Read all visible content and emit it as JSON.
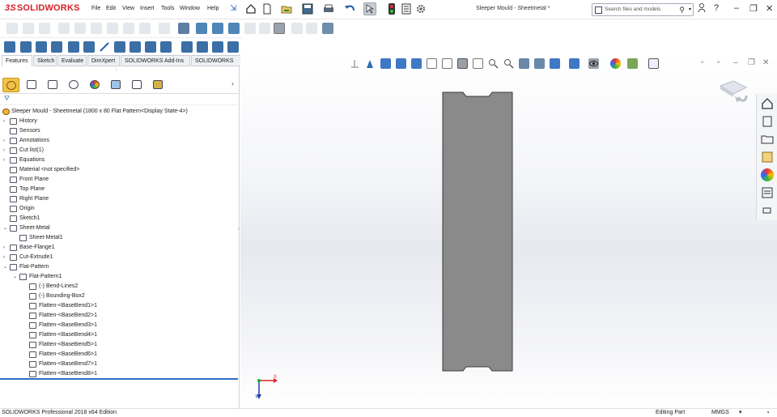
{
  "app": {
    "brand": "SOLIDWORKS",
    "brand_prefix": "3S",
    "document_title": "Sleeper Mould - Sheetmetal *",
    "menu": [
      "File",
      "Edit",
      "View",
      "Insert",
      "Tools",
      "Window",
      "Help"
    ],
    "search_placeholder": "Search files and models",
    "window_controls": {
      "help": "?",
      "minimize": "–",
      "restore": "❐",
      "close": "✕"
    }
  },
  "command_tabs": [
    {
      "label": "Features",
      "active": true
    },
    {
      "label": "Sketch",
      "active": false
    },
    {
      "label": "Evaluate",
      "active": false
    },
    {
      "label": "DimXpert",
      "active": false
    },
    {
      "label": "SOLIDWORKS Add-Ins",
      "active": false
    },
    {
      "label": "SOLIDWORKS CAM",
      "active": false
    }
  ],
  "tree": {
    "root": "Sleeper Mould - Sheetmetal  (1800 x 80 Flat Pattern<Display State-4>)",
    "items": [
      {
        "label": "History",
        "toggle": "›",
        "icon": "history-icon"
      },
      {
        "label": "Sensors",
        "toggle": "",
        "icon": "sensors-icon"
      },
      {
        "label": "Annotations",
        "toggle": "›",
        "icon": "annotations-icon"
      },
      {
        "label": "Cut list(1)",
        "toggle": "›",
        "icon": "cut-list-icon"
      },
      {
        "label": "Equations",
        "toggle": "›",
        "icon": "equations-icon"
      },
      {
        "label": "Material <not specified>",
        "toggle": "",
        "icon": "material-icon"
      },
      {
        "label": "Front Plane",
        "toggle": "",
        "icon": "plane-icon"
      },
      {
        "label": "Top Plane",
        "toggle": "",
        "icon": "plane-icon"
      },
      {
        "label": "Right Plane",
        "toggle": "",
        "icon": "plane-icon"
      },
      {
        "label": "Origin",
        "toggle": "",
        "icon": "origin-icon"
      },
      {
        "label": "Sketch1",
        "toggle": "",
        "icon": "sketch-icon"
      },
      {
        "label": "Sheet-Metal",
        "toggle": "⌄",
        "icon": "sheet-metal-icon"
      },
      {
        "label": "Sheet-Metal1",
        "toggle": "",
        "icon": "sheet-metal-feature-icon"
      },
      {
        "label": "Base-Flange1",
        "toggle": "›",
        "icon": "base-flange-icon"
      },
      {
        "label": "Cut-Extrude1",
        "toggle": "›",
        "icon": "cut-extrude-icon"
      },
      {
        "label": "Flat-Pattern",
        "toggle": "⌄",
        "icon": "flat-pattern-folder-icon"
      },
      {
        "label": "Flat-Pattern1",
        "toggle": "⌄",
        "icon": "flat-pattern-icon"
      },
      {
        "label": "(-) Bend-Lines2",
        "toggle": "",
        "icon": "sketch-icon"
      },
      {
        "label": "(-) Bounding-Box2",
        "toggle": "",
        "icon": "sketch-icon"
      },
      {
        "label": "Flatten-<BaseBend1>1",
        "toggle": "",
        "icon": "flatten-icon"
      },
      {
        "label": "Flatten-<BaseBend2>1",
        "toggle": "",
        "icon": "flatten-icon"
      },
      {
        "label": "Flatten-<BaseBend3>1",
        "toggle": "",
        "icon": "flatten-icon"
      },
      {
        "label": "Flatten-<BaseBend4>1",
        "toggle": "",
        "icon": "flatten-icon"
      },
      {
        "label": "Flatten-<BaseBend5>1",
        "toggle": "",
        "icon": "flatten-icon"
      },
      {
        "label": "Flatten-<BaseBend6>1",
        "toggle": "",
        "icon": "flatten-icon"
      },
      {
        "label": "Flatten-<BaseBend7>1",
        "toggle": "",
        "icon": "flatten-icon"
      },
      {
        "label": "Flatten-<BaseBend8>1",
        "toggle": "",
        "icon": "flatten-icon"
      }
    ]
  },
  "triad": {
    "x_label": "X",
    "y_label": "Y"
  },
  "status": {
    "product": "SOLIDWORKS Professional 2018 x64 Edition",
    "mode": "Editing Part",
    "units": "MMGS"
  },
  "colors": {
    "part_fill": "#8a8a8a",
    "part_edge": "#3a3a3a",
    "brand": "#d71f26",
    "accent": "#2f6dc8"
  }
}
